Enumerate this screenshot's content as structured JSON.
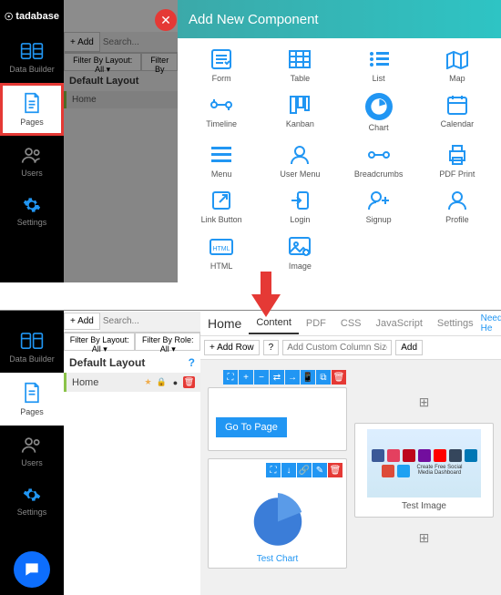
{
  "brand": "tadabase",
  "sidebar": {
    "items": [
      {
        "label": "Data Builder"
      },
      {
        "label": "Pages"
      },
      {
        "label": "Users"
      },
      {
        "label": "Settings"
      }
    ]
  },
  "toolbar": {
    "add": "+ Add",
    "search_ph": "Search...",
    "filter_layout": "Filter By Layout: All ▾",
    "filter_role": "Filter By Role: All ▾",
    "layout_title": "Default Layout",
    "page": "Home"
  },
  "panel": {
    "title": "Add New Component",
    "components": [
      {
        "name": "form",
        "label": "Form"
      },
      {
        "name": "table",
        "label": "Table"
      },
      {
        "name": "list",
        "label": "List"
      },
      {
        "name": "map",
        "label": "Map"
      },
      {
        "name": "timeline",
        "label": "Timeline"
      },
      {
        "name": "kanban",
        "label": "Kanban"
      },
      {
        "name": "chart",
        "label": "Chart",
        "selected": true
      },
      {
        "name": "calendar",
        "label": "Calendar"
      },
      {
        "name": "menu",
        "label": "Menu"
      },
      {
        "name": "user-menu",
        "label": "User Menu"
      },
      {
        "name": "breadcrumbs",
        "label": "Breadcrumbs"
      },
      {
        "name": "pdf-print",
        "label": "PDF Print"
      },
      {
        "name": "link-button",
        "label": "Link Button"
      },
      {
        "name": "login",
        "label": "Login"
      },
      {
        "name": "signup",
        "label": "Signup"
      },
      {
        "name": "profile",
        "label": "Profile"
      },
      {
        "name": "html",
        "label": "HTML"
      },
      {
        "name": "image",
        "label": "Image"
      }
    ]
  },
  "editor": {
    "title": "Home",
    "tabs": [
      "Content",
      "PDF",
      "CSS",
      "JavaScript",
      "Settings"
    ],
    "active_tab": "Content",
    "need_help": "Need He",
    "add_row": "+ Add Row",
    "col_ph": "Add Custom Column Size",
    "add": "Add",
    "go_to_page": "Go To Page",
    "test_chart": "Test Chart",
    "test_image": "Test Image",
    "img_caption": "Create Free Social Media Dashboard"
  },
  "page_icons": {
    "star": "★",
    "lock": "🔒",
    "toggle": "●",
    "trash": "🗑"
  }
}
